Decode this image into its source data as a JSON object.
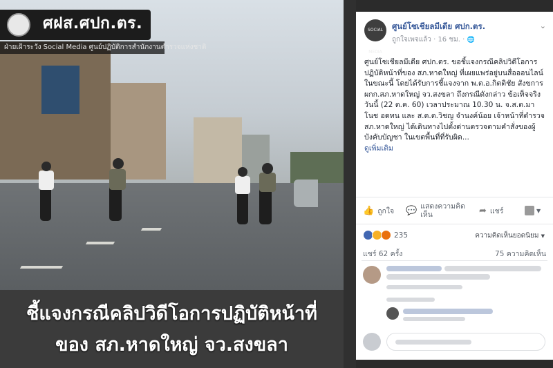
{
  "colors": {
    "link": "#365899",
    "text": "#1d2129",
    "muted": "#90949c",
    "badge_bg": "#1c1c1c",
    "caption_bg": "#3b3b3b"
  },
  "video": {
    "badge_title": "ศฝส.ศปก.ตร.",
    "badge_subtitle": "ฝ่ายเฝ้าระวัง Social Media ศูนย์ปฏิบัติการสำนักงานตำรวจแห่งชาติ",
    "caption_line1": "ชี้แจงกรณีคลิปวิดีโอการปฏิบัติหน้าที่",
    "caption_line2": "ของ สภ.หาดใหญ่ จว.สงขลา"
  },
  "post": {
    "page_name": "ศูนย์โซเชียลมีเดีย ศปก.ตร.",
    "meta": "ถูกใจเพจแล้ว · 16 ชม. · ",
    "globe_icon": "🌐",
    "menu_icon": "chevron-down-icon",
    "avatar_text": "SOCIAL MEDIA",
    "body": "ศูนย์โซเชียลมีเดีย ศปก.ตร. ขอชี้แจงกรณีคลิปวิดีโอการปฏิบัติหน้าที่ของ สภ.หาดใหญ่ ที่เผยแพร่อยู่บนสื่อออนไลน์ในขณะนี้ โดยได้รับการชี้แจงจาก พ.ต.อ.กิตติชัย สังขการ ผกก.สภ.หาดใหญ่ จว.สงขลา ถึงกรณีดังกล่าว ข้อเท็จจริง วันนี้ (22 ต.ค. 60) เวลาประมาณ 10.30 น. จ.ส.ต.มาโนช อดทน และ ส.ต.ต.วิชญ จำนงค์น้อย เจ้าหน้าที่ตำรวจ สภ.หาดใหญ่ ได้เดินทางไปตั้งด่านตรวจตามคำสั่งของผู้บังคับบัญชา ในเขตพื้นที่ที่รับผิด...",
    "see_more": "ดูเพิ่มเติม",
    "like_label": "ถูกใจ",
    "comment_label": "แสดงความคิดเห็น",
    "share_label": "แชร์",
    "reaction_count": "235",
    "sort_label": "ความคิดเห็นยอดนิยม",
    "shares_text": "แชร์ 62 ครั้ง",
    "comments_text": "75 ความคิดเห็น"
  }
}
